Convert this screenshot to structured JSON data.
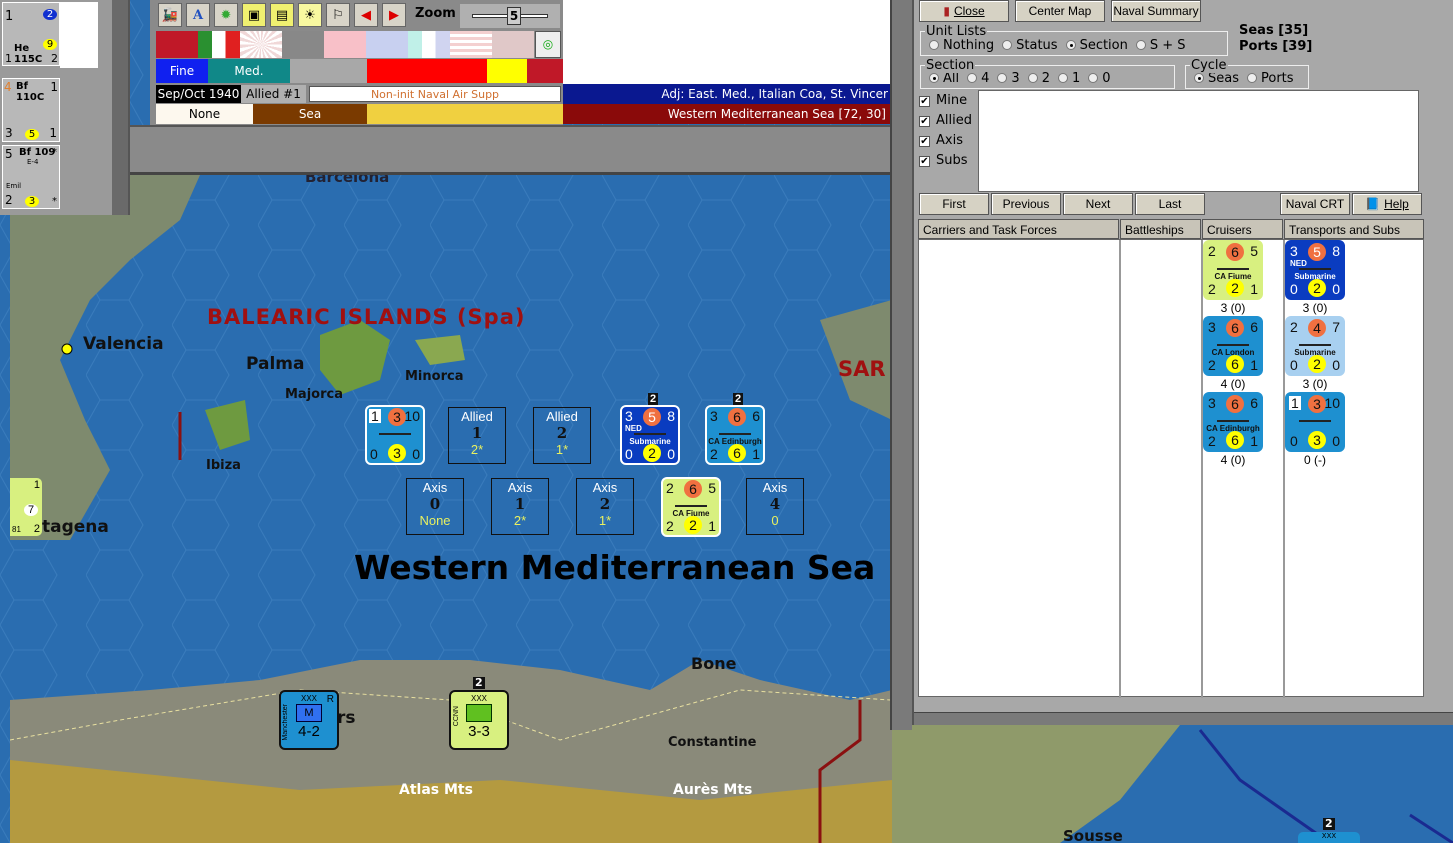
{
  "left_panel": {
    "air_units": [
      {
        "tl": "1",
        "circle": "2",
        "yc": "9",
        "name": "He 115C",
        "bl": "1",
        "br": "2"
      },
      {
        "tl": "4",
        "name": "Bf 110C",
        "tr": "1",
        "bl": "3",
        "yc": "5",
        "br": "1"
      },
      {
        "tl": "5",
        "name": "Bf 109",
        "sub": "E-4",
        "tr": "*",
        "note": "Emil",
        "bl": "2",
        "yc": "3",
        "br": "*"
      }
    ]
  },
  "toolbar": {
    "icons": [
      "train-icon",
      "font-a-icon",
      "green-gear-icon",
      "hex-grid-icon",
      "hex-number-icon",
      "weather-sun-icon",
      "flag-icon",
      "arrow-left-icon",
      "arrow-right-icon"
    ],
    "zoom_label": "Zoom",
    "zoom_value": "5",
    "weather": "Fine",
    "terrain_type": "Med.",
    "date": "Sep/Oct 1940",
    "impulse": "Allied #1",
    "phase": "Non-init Naval Air Supp",
    "adjacent": "Adj: East. Med., Italian Coa, St. Vincer",
    "control": "None",
    "hex_type": "Sea",
    "location": "Western Mediterranean Sea [72, 30]"
  },
  "map": {
    "labels": {
      "barcelona": "Barcelona",
      "balearic": "BALEARIC ISLANDS (Spa)",
      "valencia": "Valencia",
      "palma": "Palma",
      "majorca": "Majorca",
      "minorca": "Minorca",
      "ibiza": "Ibiza",
      "sar": "SAR",
      "cartagena": "tagena",
      "sea": "Western Mediterranean Sea",
      "bone": "Bone",
      "constantine": "Constantine",
      "atlas": "Atlas Mts",
      "aures": "Aurès Mts",
      "sousse": "Sousse",
      "algiers": "rs"
    },
    "counters": [
      {
        "box": "1",
        "oc": "3",
        "tr": "10",
        "bl": "0",
        "yc": "3",
        "br": "0",
        "name": "",
        "color": "#1e90d0"
      },
      {
        "tl": "3",
        "oc": "5",
        "tr": "8",
        "sub": "NED",
        "name": "Submarine",
        "bl": "0",
        "yc": "2",
        "br": "0",
        "color": "#0a3cc0",
        "stack": "2"
      },
      {
        "tl": "3",
        "oc": "6",
        "tr": "6",
        "name": "CA Edinburgh",
        "bl": "2",
        "yc": "6",
        "br": "1",
        "color": "#1e90d0",
        "stack": "2"
      },
      {
        "tl": "2",
        "oc": "6",
        "tr": "5",
        "name": "CA Fiume",
        "bl": "2",
        "yc": "2",
        "br": "1",
        "color": "#d8f080"
      }
    ],
    "status_boxes": [
      {
        "side": "Allied",
        "num": "1",
        "val": "2*"
      },
      {
        "side": "Allied",
        "num": "2",
        "val": "1*"
      },
      {
        "side": "Axis",
        "num": "0",
        "val": "None"
      },
      {
        "side": "Axis",
        "num": "1",
        "val": "2*"
      },
      {
        "side": "Axis",
        "num": "2",
        "val": "1*"
      },
      {
        "side": "Axis",
        "num": "4",
        "val": "0"
      }
    ],
    "land_units": [
      {
        "size": "XXX",
        "name": "Manchester",
        "type": "M",
        "flag": "R",
        "strength": "4-2",
        "color": "#1e90d0"
      },
      {
        "size": "XXX",
        "name": "CCNN",
        "strength": "3-3",
        "color": "#d8f080",
        "stack": "2"
      }
    ],
    "partial": {
      "cartagena_top": "1",
      "cartagena_mid": "7",
      "cartagena_bot": "81",
      "cartagena_bot2": "2",
      "bottom_right_stack": "2",
      "bottom_right_size": "XXX"
    }
  },
  "right_panel": {
    "buttons": {
      "close": "Close",
      "center_map": "Center Map",
      "naval_summary": "Naval Summary",
      "first": "First",
      "previous": "Previous",
      "next": "Next",
      "last": "Last",
      "naval_crt": "Naval CRT",
      "help": "Help"
    },
    "unit_lists": {
      "title": "Unit Lists",
      "options": [
        "Nothing",
        "Status",
        "Section",
        "S + S"
      ],
      "selected": "Section"
    },
    "seas": "Seas [35]",
    "ports": "Ports [39]",
    "section": {
      "title": "Section",
      "options": [
        "All",
        "4",
        "3",
        "2",
        "1",
        "0"
      ],
      "selected": "All"
    },
    "cycle": {
      "title": "Cycle",
      "options": [
        "Seas",
        "Ports"
      ],
      "selected": "Seas"
    },
    "filters": [
      {
        "label": "Mine",
        "checked": true
      },
      {
        "label": "Allied",
        "checked": true
      },
      {
        "label": "Axis",
        "checked": true
      },
      {
        "label": "Subs",
        "checked": true
      }
    ],
    "columns": [
      "Carriers and Task Forces",
      "Battleships",
      "Cruisers",
      "Transports and Subs"
    ],
    "cruisers": [
      {
        "tl": "2",
        "oc": "6",
        "tr": "5",
        "name": "CA Fiume",
        "bl": "2",
        "yc": "2",
        "br": "1",
        "color": "#d8f080",
        "under": "3 (0)"
      },
      {
        "tl": "3",
        "oc": "6",
        "tr": "6",
        "name": "CA London",
        "bl": "2",
        "yc": "6",
        "br": "1",
        "color": "#1e90d0",
        "under": "4 (0)"
      },
      {
        "tl": "3",
        "oc": "6",
        "tr": "6",
        "name": "CA Edinburgh",
        "bl": "2",
        "yc": "6",
        "br": "1",
        "color": "#1e90d0",
        "under": "4 (0)"
      }
    ],
    "transports": [
      {
        "tl": "3",
        "oc": "5",
        "tr": "8",
        "sub": "NED",
        "name": "Submarine",
        "bl": "0",
        "yc": "2",
        "br": "0",
        "color": "#0a3cc0",
        "under": "3 (0)",
        "light": true
      },
      {
        "tl": "2",
        "oc": "4",
        "tr": "7",
        "name": "Submarine",
        "bl": "0",
        "yc": "2",
        "br": "0",
        "color": "#a8d0f0",
        "under": "3 (0)"
      },
      {
        "box": "1",
        "oc": "3",
        "tr": "10",
        "name": "",
        "bl": "0",
        "yc": "3",
        "br": "0",
        "color": "#1e90d0",
        "under": "0 (-)"
      }
    ]
  }
}
